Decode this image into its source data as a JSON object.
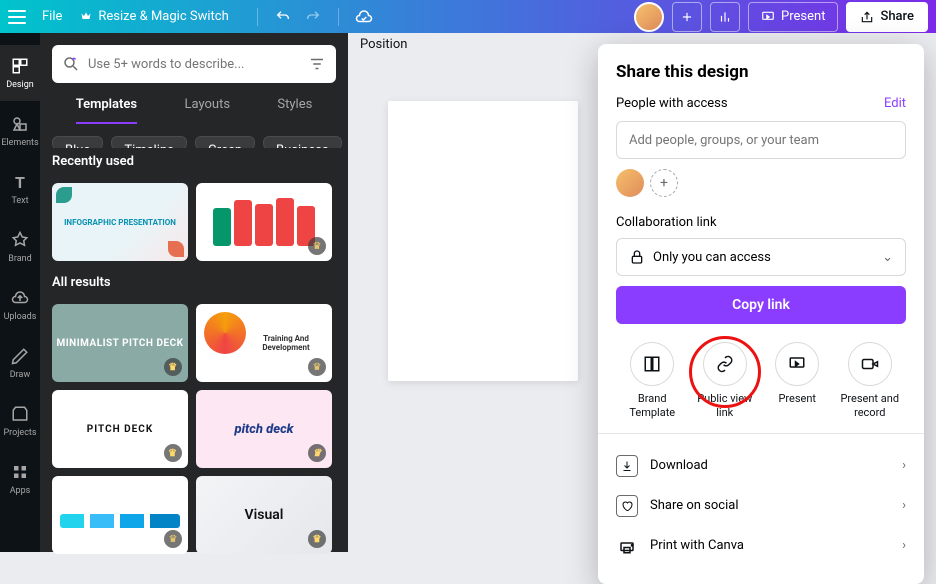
{
  "topbar": {
    "file": "File",
    "resize": "Resize & Magic Switch",
    "present": "Present",
    "share": "Share"
  },
  "rail": {
    "design": "Design",
    "elements": "Elements",
    "text": "Text",
    "brand": "Brand",
    "uploads": "Uploads",
    "draw": "Draw",
    "projects": "Projects",
    "apps": "Apps"
  },
  "panel": {
    "search_placeholder": "Use 5+ words to describe...",
    "tabs": {
      "templates": "Templates",
      "layouts": "Layouts",
      "styles": "Styles"
    },
    "chips": [
      "Blue",
      "Timeline",
      "Green",
      "Business"
    ],
    "recent_title": "Recently used",
    "all_title": "All results",
    "thumbs": {
      "t1": "INFOGRAPHIC PRESENTATION",
      "t3": "MINIMALIST PITCH DECK",
      "t4": "Training And Development",
      "t5": "PITCH DECK",
      "t6": "pitch deck",
      "t8": "Visual"
    }
  },
  "canvas": {
    "position": "Position"
  },
  "share_panel": {
    "title": "Share this design",
    "people_label": "People with access",
    "edit": "Edit",
    "add_placeholder": "Add people, groups, or your team",
    "collab_label": "Collaboration link",
    "access_value": "Only you can access",
    "copy": "Copy link",
    "actions": {
      "brand": "Brand Template",
      "public": "Public view link",
      "present": "Present",
      "record": "Present and record"
    },
    "list": {
      "download": "Download",
      "social": "Share on social",
      "print": "Print with Canva"
    }
  }
}
